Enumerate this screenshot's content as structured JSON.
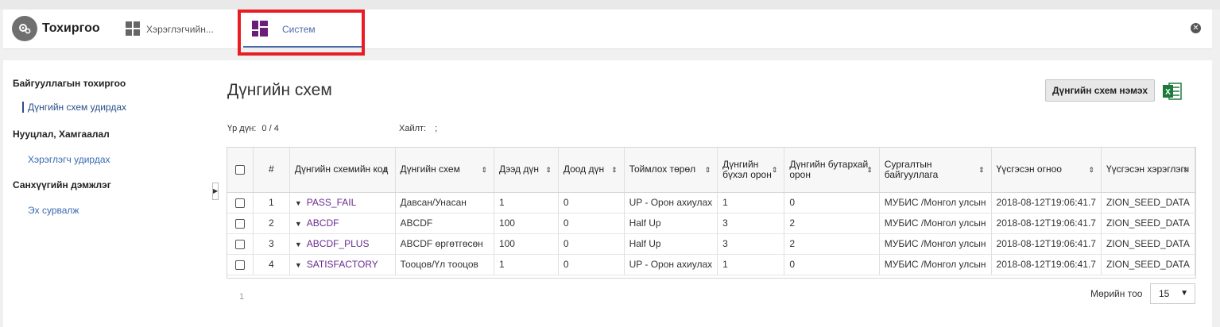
{
  "header": {
    "app_title": "Тохиргоо",
    "tabs": [
      {
        "label": "Хэрэглэгчийн...",
        "icon": "grid-icon"
      },
      {
        "label": "Систем",
        "icon": "dashboard-icon",
        "active": true
      }
    ]
  },
  "sidebar": {
    "groups": [
      {
        "label": "Байгууллагын тохиргоо",
        "items": [
          "Дүнгийн схем удирдах"
        ]
      },
      {
        "label": "Нууцлал, Хамгаалал",
        "items": [
          "Хэрэглэгч удирдах"
        ]
      },
      {
        "label": "Санхүүгийн дэмжлэг",
        "items": [
          "Эх сурвалж"
        ]
      }
    ],
    "active_item": "Дүнгийн схем удирдах"
  },
  "main": {
    "title": "Дүнгийн схем",
    "add_button": "Дүнгийн схем нэмэх",
    "result_label": "Үр дүн:",
    "result_value": "0 / 4",
    "filter_label": "Хайлт:",
    "filter_value": ";",
    "columns": [
      "#",
      "Дүнгийн схемийн код",
      "Дүнгийн схем",
      "Дээд дүн",
      "Доод дүн",
      "Тоймлох төрөл",
      "Дүнгийн бүхэл орон",
      "Дүнгийн бутархай орон",
      "Сургалтын байгууллага",
      "Үүсгэсэн огноо",
      "Үүсгэсэн хэрэглэгч"
    ],
    "rows": [
      {
        "num": "1",
        "code": "PASS_FAIL",
        "name": "Давсан/Унасан",
        "max": "1",
        "min": "0",
        "rounding": "UP - Орон ахиулах",
        "int_digits": "1",
        "dec_digits": "0",
        "org": "МУБИС /Монгол улсын",
        "created": "2018-08-12T19:06:41.7",
        "user": "ZION_SEED_DATA"
      },
      {
        "num": "2",
        "code": "ABCDF",
        "name": "ABCDF",
        "max": "100",
        "min": "0",
        "rounding": "Half Up",
        "int_digits": "3",
        "dec_digits": "2",
        "org": "МУБИС /Монгол улсын",
        "created": "2018-08-12T19:06:41.7",
        "user": "ZION_SEED_DATA"
      },
      {
        "num": "3",
        "code": "ABCDF_PLUS",
        "name": "ABCDF өргөтгөсөн",
        "max": "100",
        "min": "0",
        "rounding": "Half Up",
        "int_digits": "3",
        "dec_digits": "2",
        "org": "МУБИС /Монгол улсын",
        "created": "2018-08-12T19:06:41.7",
        "user": "ZION_SEED_DATA"
      },
      {
        "num": "4",
        "code": "SATISFACTORY",
        "name": "Тооцов/Үл тооцов",
        "max": "1",
        "min": "0",
        "rounding": "UP - Орон ахиулах",
        "int_digits": "1",
        "dec_digits": "0",
        "org": "МУБИС /Монгол улсын",
        "created": "2018-08-12T19:06:41.7",
        "user": "ZION_SEED_DATA"
      }
    ],
    "pager": {
      "current_page": "1",
      "page_size_label": "Мөрийн тоо",
      "page_size": "15"
    }
  },
  "colors": {
    "accent": "#4a6aa8",
    "link_purple": "#6a2b8f",
    "highlight_red": "#e81c24",
    "excel_green": "#1e7a3c"
  }
}
